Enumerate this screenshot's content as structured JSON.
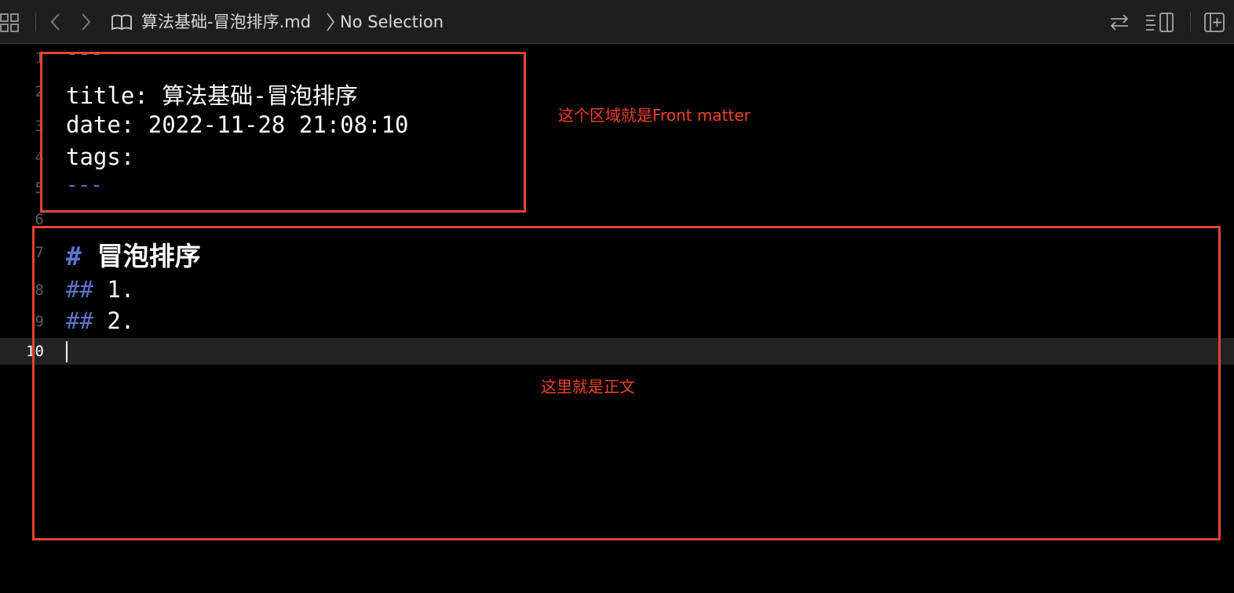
{
  "toolbar": {
    "breadcrumb_file": "算法基础-冒泡排序.md",
    "breadcrumb_selection": "No Selection",
    "icons": [
      "grid-icon",
      "back-chevron-icon",
      "forward-chevron-icon",
      "book-icon",
      "breadcrumb-chevron-icon",
      "swap-arrows-icon",
      "inspector-toggle-icon",
      "add-editor-icon"
    ]
  },
  "editor": {
    "line_numbers": [
      "1",
      "2",
      "3",
      "4",
      "5",
      "6",
      "7",
      "8",
      "9",
      "10"
    ],
    "active_line": "10",
    "lines": {
      "l1_dashes": "---",
      "l2_key": "title:",
      "l2_value": "算法基础-冒泡排序",
      "l3_key": "date:",
      "l3_value": "2022-11-28 21:08:10",
      "l4_key": "tags:",
      "l5_dashes": "---",
      "l7_mark": "#",
      "l7_text": "冒泡排序",
      "l8_mark": "##",
      "l8_text": "1.",
      "l9_mark": "##",
      "l9_text": "2."
    }
  },
  "annotations": {
    "front_matter_note": "这个区域就是Front matter",
    "body_note": "这里就是正文"
  },
  "colors": {
    "background": "#000000",
    "toolbar": "#1e1e1e",
    "markdown_marker": "#5b74c9",
    "annotation_red": "#e8432e",
    "current_line": "#232323"
  }
}
